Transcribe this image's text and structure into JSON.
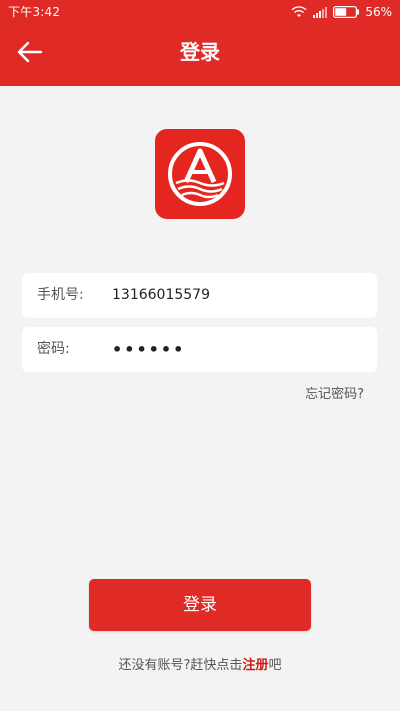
{
  "status_bar": {
    "time": "下午3:42",
    "battery": "56%",
    "icons": [
      "wifi-icon",
      "signal-icon",
      "battery-icon"
    ]
  },
  "nav": {
    "back_icon": "arrow-left-icon",
    "title": "登录"
  },
  "logo": {
    "letter": "A",
    "background": "#e52620"
  },
  "form": {
    "phone_label": "手机号:",
    "phone_value": "13166015579",
    "password_label": "密码:",
    "password_value": "••••••"
  },
  "forgot_password": "忘记密码?",
  "login_button": "登录",
  "register": {
    "prefix": "还没有账号?赶快点击",
    "link": "注册",
    "suffix": "吧"
  },
  "colors": {
    "primary": "#e02a26",
    "background": "#f3f3f3",
    "link": "#c8201c"
  }
}
